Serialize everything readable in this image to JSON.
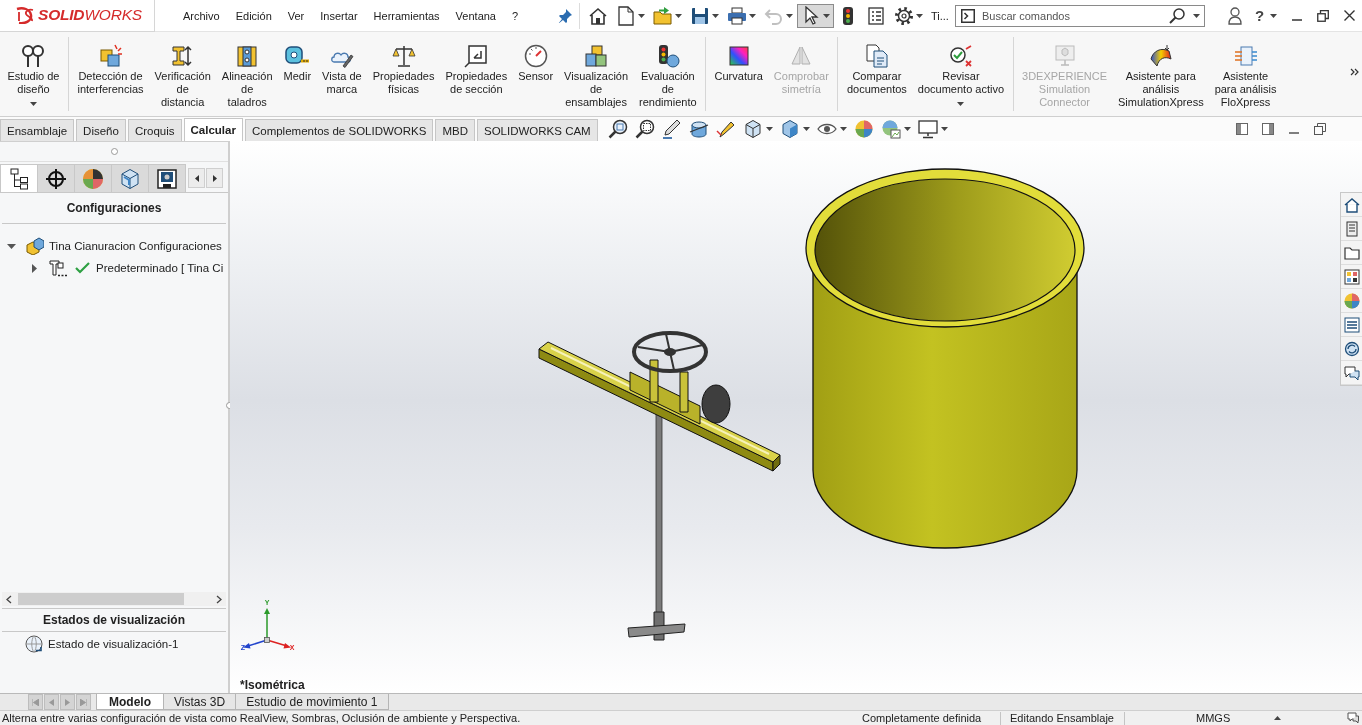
{
  "app": {
    "logo": "**SOLID**WORKS"
  },
  "menu": [
    "Archivo",
    "Edición",
    "Ver",
    "Insertar",
    "Herramientas",
    "Ventana",
    "?"
  ],
  "quick_access": {
    "tools": [
      {
        "dropdown": false,
        "disabled": false,
        "pressed": false
      },
      {
        "dropdown": true,
        "disabled": false,
        "pressed": false
      },
      {
        "dropdown": true,
        "disabled": false,
        "pressed": false
      },
      {
        "dropdown": true,
        "disabled": false,
        "pressed": false
      },
      {
        "dropdown": true,
        "disabled": false,
        "pressed": false
      },
      {
        "dropdown": true,
        "disabled": true,
        "pressed": false
      },
      {
        "dropdown": true,
        "disabled": false,
        "pressed": true
      },
      {
        "dropdown": false,
        "disabled": false,
        "pressed": false
      },
      {
        "dropdown": false,
        "disabled": false,
        "pressed": false
      },
      {
        "dropdown": true,
        "disabled": false,
        "pressed": false
      }
    ],
    "title": "Ti...",
    "search": {
      "placeholder": "Buscar comandos"
    },
    "help": "?"
  },
  "ribbon": {
    "groups": [
      [
        {
          "label": "Estudio de\ndiseño",
          "disabled": false,
          "dropdown": true
        }
      ],
      [
        {
          "label": "Detección de\ninterferencias",
          "disabled": false
        },
        {
          "label": "Verificación\nde\ndistancia",
          "disabled": false
        },
        {
          "label": "Alineación\nde\ntaladros",
          "disabled": false
        },
        {
          "label": "Medir",
          "disabled": false
        },
        {
          "label": "Vista de\nmarca",
          "disabled": false
        },
        {
          "label": "Propiedades\nfísicas",
          "disabled": false
        },
        {
          "label": "Propiedades\nde sección",
          "disabled": false
        },
        {
          "label": "Sensor",
          "disabled": false
        },
        {
          "label": "Visualización\nde\nensamblajes",
          "disabled": false
        },
        {
          "label": "Evaluación\nde\nrendimiento",
          "disabled": false
        }
      ],
      [
        {
          "label": "Curvatura",
          "disabled": false
        },
        {
          "label": "Comprobar\nsimetría",
          "disabled": true
        }
      ],
      [
        {
          "label": "Comparar\ndocumentos",
          "disabled": false
        },
        {
          "label": "Revisar\ndocumento activo",
          "disabled": false,
          "dropdown": true
        }
      ],
      [
        {
          "label": "3DEXPERIENCE\nSimulation\nConnector",
          "disabled": true
        },
        {
          "label": "Asistente para\nanálisis\nSimulationXpress",
          "disabled": false
        },
        {
          "label": "Asistente\npara análisis\nFloXpress",
          "disabled": false
        }
      ]
    ]
  },
  "command_tabs": [
    {
      "label": "Ensamblaje",
      "selected": false
    },
    {
      "label": "Diseño",
      "selected": false
    },
    {
      "label": "Croquis",
      "selected": false
    },
    {
      "label": "Calcular",
      "selected": true
    },
    {
      "label": "Complementos de SOLIDWORKS",
      "selected": false
    },
    {
      "label": "MBD",
      "selected": false
    },
    {
      "label": "SOLIDWORKS CAM",
      "selected": false
    }
  ],
  "heads_up_toolbar": [
    {
      "dropdown": false
    },
    {
      "dropdown": false
    },
    {
      "dropdown": false
    },
    {
      "dropdown": false
    },
    {
      "dropdown": false
    },
    {
      "dropdown": true
    },
    {
      "dropdown": true
    },
    {
      "dropdown": true
    },
    {
      "dropdown": false
    },
    {
      "dropdown": true
    },
    {
      "dropdown": true
    }
  ],
  "feature_manager": {
    "tabs": [
      {
        "selected": true
      },
      {
        "selected": false
      },
      {
        "selected": false
      },
      {
        "selected": false
      },
      {
        "selected": false
      }
    ],
    "configurations": {
      "title": "Configuraciones",
      "tree": [
        {
          "label": "Tina Cianuracion Configuraciones",
          "expanded": true,
          "active": false,
          "children": [
            {
              "label": "Predeterminado [ Tina Ci",
              "expanded": false,
              "active": true
            }
          ]
        }
      ]
    },
    "display_states": {
      "title": "Estados de visualización",
      "items": [
        {
          "label": "Estado de visualización-1"
        }
      ]
    }
  },
  "viewport": {
    "view_label": "*Isométrica",
    "triad": [
      {
        "kind": "y",
        "text": "Y"
      },
      {
        "kind": "x",
        "text": "X"
      },
      {
        "kind": "z",
        "text": "Z"
      }
    ]
  },
  "bottom_tabs": [
    {
      "label": "Modelo",
      "selected": true
    },
    {
      "label": "Vistas 3D",
      "selected": false
    },
    {
      "label": "Estudio de movimiento 1",
      "selected": false
    }
  ],
  "status_bar": {
    "message": "Alterna entre varias configuración de vista como RealView, Sombras, Oclusión de ambiente y Perspectiva.",
    "fields": [
      "Completamente definida",
      "Editando Ensamblaje",
      "MMGS"
    ]
  }
}
